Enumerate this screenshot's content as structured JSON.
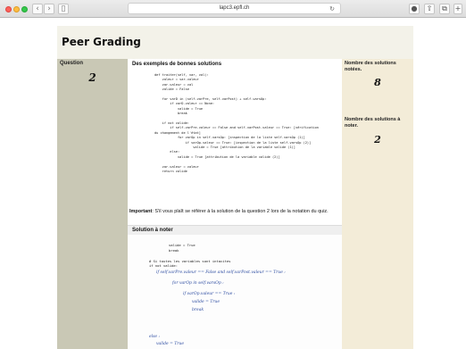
{
  "browser": {
    "url": "lapc3.epfl.ch"
  },
  "page": {
    "title": "Peer Grading"
  },
  "left": {
    "label": "Question",
    "number": "2"
  },
  "middle": {
    "heading": "Des exemples de bonnes solutions",
    "code_lines": [
      "def traiter(self, var, val):",
      "    valeur = var.valeur",
      "    var.valeur = val",
      "    valide = False",
      "",
      "    for varD in (self.varPre, self.varPost) + self.varsOp:",
      "        if varD.valeur == None:",
      "            valide = True",
      "            break",
      "",
      "    if not valide:",
      "        if self.varPre.valeur == False and self.varPost.valeur == True: [vérification",
      "du changement de l'état]",
      "            for varOp in self.varsOp: [inspection de la liste self.varsOp (1)]",
      "                if varOp.valeur == True: [inspection de la liste self.varsOp (2)]",
      "                    valide = True [attribution de la variable valide (1)]",
      "        else:",
      "            valide = True [attribution de la variable valide (2)]",
      "",
      "    var.valeur = valeur",
      "    return valide"
    ],
    "important_bold": "Important",
    "important_text": ": S'il vous plaît se référer à la solution de la question 2 lors de la notation du quiz.",
    "solution_heading": "Solution à noter",
    "solution_typed": [
      "valide = True",
      "break",
      "",
      "# Si toutes les variables sont intacites",
      "if not valide:"
    ],
    "solution_hand": [
      "if self.varPre.valeur == False and self.varPost.valeur == True :",
      "for varOp in self.varsOp :",
      "if varOp.valeur == True :",
      "valide = True",
      "break",
      "else :",
      "valide = True"
    ]
  },
  "right": {
    "graded_label": "Nombre des solutions notées.",
    "graded_count": "8",
    "to_grade_label": "Nombre des solutions à noter.",
    "to_grade_count": "2"
  }
}
